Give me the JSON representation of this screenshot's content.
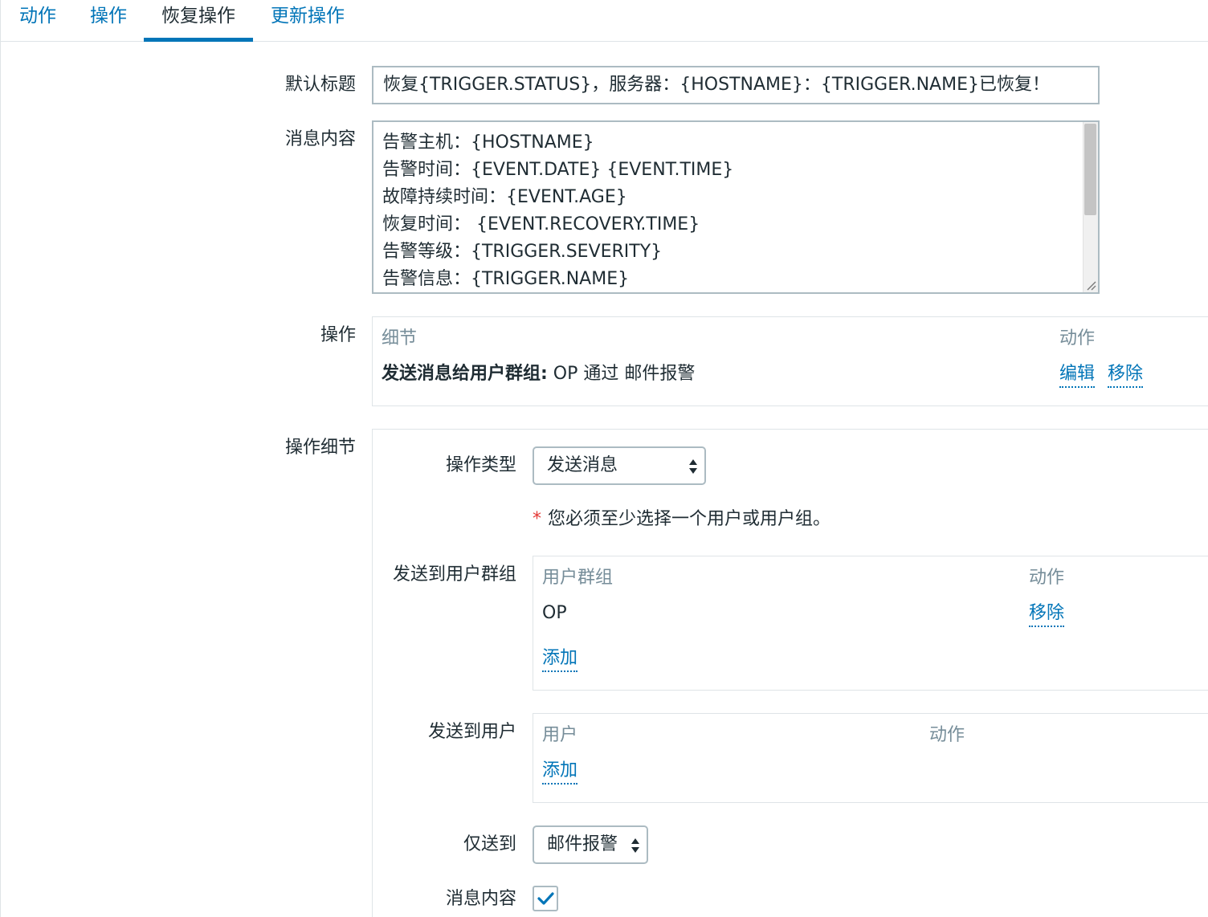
{
  "tabs": [
    {
      "label": "动作",
      "active": false
    },
    {
      "label": "操作",
      "active": false
    },
    {
      "label": "恢复操作",
      "active": true
    },
    {
      "label": "更新操作",
      "active": false
    }
  ],
  "form": {
    "default_subject_label": "默认标题",
    "default_subject_value": "恢复{TRIGGER.STATUS}，服务器：{HOSTNAME}：{TRIGGER.NAME}已恢复！",
    "message_label": "消息内容",
    "message_lines": [
      "告警主机：{HOSTNAME}",
      "告警时间：{EVENT.DATE} {EVENT.TIME}",
      "故障持续时间：{EVENT.AGE}",
      "恢复时间： {EVENT.RECOVERY.TIME}",
      "告警等级：{TRIGGER.SEVERITY}",
      "告警信息：{TRIGGER.NAME}"
    ],
    "operations_label": "操作",
    "operations": {
      "col_details": "细节",
      "col_action": "动作",
      "row_bold": "发送消息给用户群组:",
      "row_rest": " OP 通过 邮件报警",
      "edit": "编辑",
      "remove": "移除"
    },
    "operation_details_label": "操作细节",
    "details": {
      "op_type_label": "操作类型",
      "op_type_value": "发送消息",
      "required_star": "*",
      "required_note": "您必须至少选择一个用户或用户组。",
      "send_groups_label": "发送到用户群组",
      "groups_col_name": "用户群组",
      "groups_col_action": "动作",
      "group_row_name": "OP",
      "group_row_remove": "移除",
      "groups_add": "添加",
      "send_users_label": "发送到用户",
      "users_col_name": "用户",
      "users_col_action": "动作",
      "users_add": "添加",
      "send_only_label": "仅送到",
      "send_only_value": "邮件报警",
      "msg_content_label": "消息内容",
      "msg_content_checked": true
    }
  },
  "colors": {
    "link": "#0275b8",
    "muted_header": "#768d99",
    "text": "#1f2c33",
    "required": "#e33734"
  }
}
